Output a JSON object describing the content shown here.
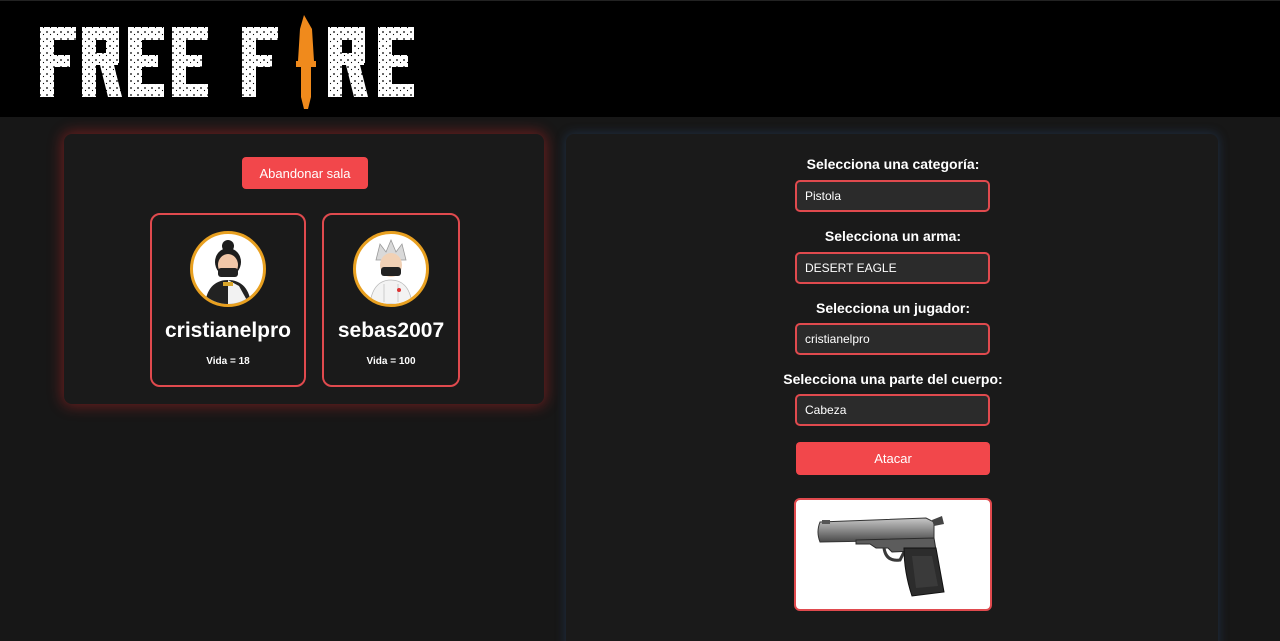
{
  "header": {
    "logo_text": "FREE FIRE",
    "logo_icon": "knife-icon"
  },
  "room": {
    "leave_label": "Abandonar sala",
    "players": [
      {
        "name": "cristianelpro",
        "life_text": "Vida = 18",
        "life": 18,
        "avatar": "avatar-female-icon"
      },
      {
        "name": "sebas2007",
        "life_text": "Vida = 100",
        "life": 100,
        "avatar": "avatar-male-icon"
      }
    ]
  },
  "attack_form": {
    "category_label": "Selecciona una categoría:",
    "category_value": "Pistola",
    "weapon_label": "Selecciona un arma:",
    "weapon_value": "DESERT EAGLE",
    "player_label": "Selecciona un jugador:",
    "player_value": "cristianelpro",
    "body_part_label": "Selecciona una parte del cuerpo:",
    "body_part_value": "Cabeza",
    "attack_label": "Atacar",
    "weapon_image": "pistol-icon"
  },
  "colors": {
    "accent": "#f2474b",
    "border": "#e04a4e",
    "logo_orange": "#f08a1c",
    "avatar_ring": "#e8a020",
    "background": "#171717"
  }
}
